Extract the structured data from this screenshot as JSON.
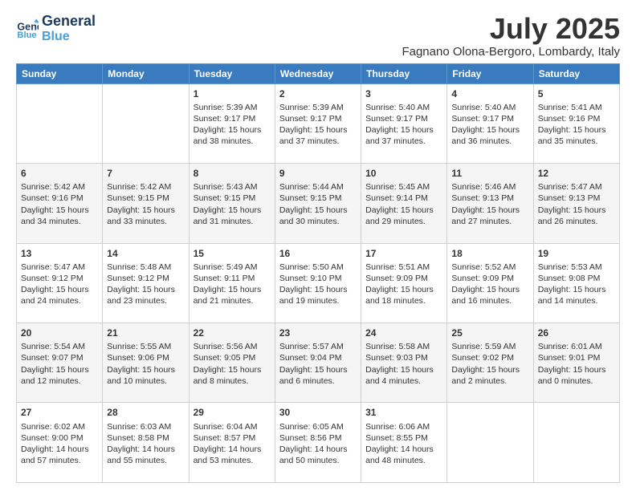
{
  "header": {
    "logo_line1": "General",
    "logo_line2": "Blue",
    "month": "July 2025",
    "location": "Fagnano Olona-Bergoro, Lombardy, Italy"
  },
  "days_of_week": [
    "Sunday",
    "Monday",
    "Tuesday",
    "Wednesday",
    "Thursday",
    "Friday",
    "Saturday"
  ],
  "weeks": [
    [
      {
        "day": "",
        "detail": ""
      },
      {
        "day": "",
        "detail": ""
      },
      {
        "day": "1",
        "detail": "Sunrise: 5:39 AM\nSunset: 9:17 PM\nDaylight: 15 hours and 38 minutes."
      },
      {
        "day": "2",
        "detail": "Sunrise: 5:39 AM\nSunset: 9:17 PM\nDaylight: 15 hours and 37 minutes."
      },
      {
        "day": "3",
        "detail": "Sunrise: 5:40 AM\nSunset: 9:17 PM\nDaylight: 15 hours and 37 minutes."
      },
      {
        "day": "4",
        "detail": "Sunrise: 5:40 AM\nSunset: 9:17 PM\nDaylight: 15 hours and 36 minutes."
      },
      {
        "day": "5",
        "detail": "Sunrise: 5:41 AM\nSunset: 9:16 PM\nDaylight: 15 hours and 35 minutes."
      }
    ],
    [
      {
        "day": "6",
        "detail": "Sunrise: 5:42 AM\nSunset: 9:16 PM\nDaylight: 15 hours and 34 minutes."
      },
      {
        "day": "7",
        "detail": "Sunrise: 5:42 AM\nSunset: 9:15 PM\nDaylight: 15 hours and 33 minutes."
      },
      {
        "day": "8",
        "detail": "Sunrise: 5:43 AM\nSunset: 9:15 PM\nDaylight: 15 hours and 31 minutes."
      },
      {
        "day": "9",
        "detail": "Sunrise: 5:44 AM\nSunset: 9:15 PM\nDaylight: 15 hours and 30 minutes."
      },
      {
        "day": "10",
        "detail": "Sunrise: 5:45 AM\nSunset: 9:14 PM\nDaylight: 15 hours and 29 minutes."
      },
      {
        "day": "11",
        "detail": "Sunrise: 5:46 AM\nSunset: 9:13 PM\nDaylight: 15 hours and 27 minutes."
      },
      {
        "day": "12",
        "detail": "Sunrise: 5:47 AM\nSunset: 9:13 PM\nDaylight: 15 hours and 26 minutes."
      }
    ],
    [
      {
        "day": "13",
        "detail": "Sunrise: 5:47 AM\nSunset: 9:12 PM\nDaylight: 15 hours and 24 minutes."
      },
      {
        "day": "14",
        "detail": "Sunrise: 5:48 AM\nSunset: 9:12 PM\nDaylight: 15 hours and 23 minutes."
      },
      {
        "day": "15",
        "detail": "Sunrise: 5:49 AM\nSunset: 9:11 PM\nDaylight: 15 hours and 21 minutes."
      },
      {
        "day": "16",
        "detail": "Sunrise: 5:50 AM\nSunset: 9:10 PM\nDaylight: 15 hours and 19 minutes."
      },
      {
        "day": "17",
        "detail": "Sunrise: 5:51 AM\nSunset: 9:09 PM\nDaylight: 15 hours and 18 minutes."
      },
      {
        "day": "18",
        "detail": "Sunrise: 5:52 AM\nSunset: 9:09 PM\nDaylight: 15 hours and 16 minutes."
      },
      {
        "day": "19",
        "detail": "Sunrise: 5:53 AM\nSunset: 9:08 PM\nDaylight: 15 hours and 14 minutes."
      }
    ],
    [
      {
        "day": "20",
        "detail": "Sunrise: 5:54 AM\nSunset: 9:07 PM\nDaylight: 15 hours and 12 minutes."
      },
      {
        "day": "21",
        "detail": "Sunrise: 5:55 AM\nSunset: 9:06 PM\nDaylight: 15 hours and 10 minutes."
      },
      {
        "day": "22",
        "detail": "Sunrise: 5:56 AM\nSunset: 9:05 PM\nDaylight: 15 hours and 8 minutes."
      },
      {
        "day": "23",
        "detail": "Sunrise: 5:57 AM\nSunset: 9:04 PM\nDaylight: 15 hours and 6 minutes."
      },
      {
        "day": "24",
        "detail": "Sunrise: 5:58 AM\nSunset: 9:03 PM\nDaylight: 15 hours and 4 minutes."
      },
      {
        "day": "25",
        "detail": "Sunrise: 5:59 AM\nSunset: 9:02 PM\nDaylight: 15 hours and 2 minutes."
      },
      {
        "day": "26",
        "detail": "Sunrise: 6:01 AM\nSunset: 9:01 PM\nDaylight: 15 hours and 0 minutes."
      }
    ],
    [
      {
        "day": "27",
        "detail": "Sunrise: 6:02 AM\nSunset: 9:00 PM\nDaylight: 14 hours and 57 minutes."
      },
      {
        "day": "28",
        "detail": "Sunrise: 6:03 AM\nSunset: 8:58 PM\nDaylight: 14 hours and 55 minutes."
      },
      {
        "day": "29",
        "detail": "Sunrise: 6:04 AM\nSunset: 8:57 PM\nDaylight: 14 hours and 53 minutes."
      },
      {
        "day": "30",
        "detail": "Sunrise: 6:05 AM\nSunset: 8:56 PM\nDaylight: 14 hours and 50 minutes."
      },
      {
        "day": "31",
        "detail": "Sunrise: 6:06 AM\nSunset: 8:55 PM\nDaylight: 14 hours and 48 minutes."
      },
      {
        "day": "",
        "detail": ""
      },
      {
        "day": "",
        "detail": ""
      }
    ]
  ]
}
